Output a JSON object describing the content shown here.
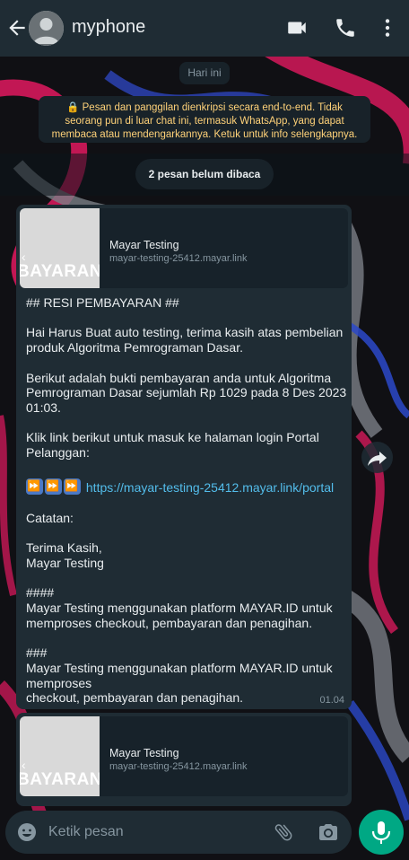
{
  "header": {
    "contact_name": "myphone",
    "icons": [
      "back-arrow-icon",
      "avatar-icon",
      "video-call-icon",
      "phone-icon",
      "more-vert-icon"
    ]
  },
  "chat": {
    "date_chip": "Hari ini",
    "encryption_notice": "Pesan dan panggilan dienkripsi secara end-to-end. Tidak seorang pun di luar chat ini, termasuk WhatsApp, yang dapat membaca atau mendengarkannya. Ketuk untuk info selengkapnya.",
    "unread_chip": "2 pesan belum dibaca",
    "messages": [
      {
        "preview_title": "Mayar Testing",
        "preview_url": "mayar-testing-25412.mayar.link",
        "thumb_text": "BAYARAN",
        "body_lines": {
          "l1": "## RESI PEMBAYARAN ##",
          "l2": "Hai Harus Buat auto testing, terima kasih atas pembelian produk Algoritma Pemrograman Dasar.",
          "l3": "Berikut adalah bukti pembayaran anda untuk Algoritma Pemrograman Dasar sejumlah Rp 1029 pada 8 Des 2023 01:03.",
          "l4": "Klik link berikut untuk masuk ke halaman login Portal Pelanggan:",
          "link": "https://mayar-testing-25412.mayar.link/portal",
          "l5": "Catatan:",
          "l6": "Terima Kasih,\nMayar Testing",
          "l7": "####\nMayar Testing menggunakan platform MAYAR.ID untuk memproses checkout, pembayaran dan penagihan.",
          "l8": "###\nMayar Testing menggunakan platform MAYAR.ID untuk memproses\ncheckout, pembayaran dan penagihan."
        },
        "time": "01.04"
      },
      {
        "preview_title": "Mayar Testing",
        "preview_url": "mayar-testing-25412.mayar.link",
        "thumb_text": "BAYARAN"
      }
    ]
  },
  "composer": {
    "placeholder": "Ketik pesan"
  },
  "colors": {
    "header_bg": "#1f2c34",
    "bubble_bg": "#1f2c34",
    "link": "#53bdeb",
    "mic_button": "#00a884",
    "encryption_text": "#ffd279"
  }
}
